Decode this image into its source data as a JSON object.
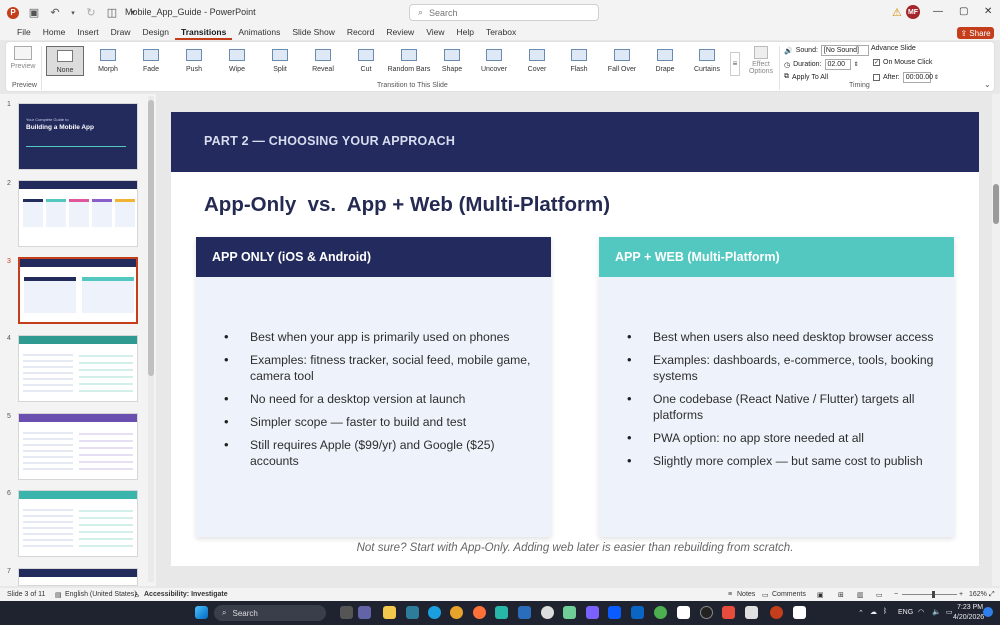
{
  "app": {
    "doc_title": "Mobile_App_Guide",
    "app_name": "PowerPoint",
    "search_placeholder": "Search",
    "user_initials": "MF"
  },
  "menu": {
    "tabs": [
      "File",
      "Home",
      "Insert",
      "Draw",
      "Design",
      "Transitions",
      "Animations",
      "Slide Show",
      "Record",
      "Review",
      "View",
      "Help",
      "Terabox"
    ],
    "active_tab": "Transitions",
    "share_label": "Share"
  },
  "ribbon": {
    "preview_label": "Preview",
    "preview_group": "Preview",
    "transitions": [
      "None",
      "Morph",
      "Fade",
      "Push",
      "Wipe",
      "Split",
      "Reveal",
      "Cut",
      "Random Bars",
      "Shape",
      "Uncover",
      "Cover",
      "Flash",
      "Fall Over",
      "Drape",
      "Curtains"
    ],
    "selected_transition": "None",
    "group_label": "Transition to This Slide",
    "effect_options": "Effect Options",
    "timing": {
      "sound_label": "Sound:",
      "sound_value": "[No Sound]",
      "duration_label": "Duration:",
      "duration_value": "02.00",
      "apply_all": "Apply To All",
      "advance_label": "Advance Slide",
      "on_click": "On Mouse Click",
      "after_label": "After:",
      "after_value": "00:00.00",
      "group_label": "Timing"
    }
  },
  "thumbnails": {
    "numbers": [
      "1",
      "2",
      "3",
      "4",
      "5",
      "6",
      "7"
    ],
    "selected": "3",
    "t1_title_a": "Your Complete Guide to",
    "t1_title_b": "Building a Mobile App"
  },
  "slide": {
    "section_header": "PART 2 — CHOOSING YOUR APPROACH",
    "title": "App-Only  vs.  App + Web (Multi-Platform)",
    "left": {
      "heading": "APP ONLY  (iOS & Android)",
      "bullets": [
        "Best when your app is primarily used on phones",
        "Examples: fitness tracker, social feed, mobile game, camera tool",
        "No need for a desktop version at launch",
        "Simpler scope — faster to build and test",
        "Still requires Apple ($99/yr) and Google ($25) accounts"
      ]
    },
    "right": {
      "heading": "APP + WEB  (Multi-Platform)",
      "bullets": [
        "Best when users also need desktop browser access",
        "Examples: dashboards, e-commerce, tools, booking systems",
        "One codebase (React Native / Flutter) targets all platforms",
        "PWA option: no app store needed at all",
        "Slightly more complex — but same cost to publish"
      ]
    },
    "footnote": "Not sure? Start with App-Only. Adding web later is easier than rebuilding from scratch."
  },
  "status": {
    "slide_of": "Slide 3 of 11",
    "language": "English (United States)",
    "accessibility": "Accessibility: Investigate",
    "notes": "Notes",
    "comments": "Comments",
    "zoom": "162%"
  },
  "taskbar": {
    "search": "Search",
    "lang": "ENG",
    "time": "7:23 PM",
    "date": "4/20/2026"
  },
  "colors": {
    "band": "#222a5e",
    "left_head": "#222a5e",
    "right_head": "#52c8c0",
    "accent": "#c43e1c"
  }
}
